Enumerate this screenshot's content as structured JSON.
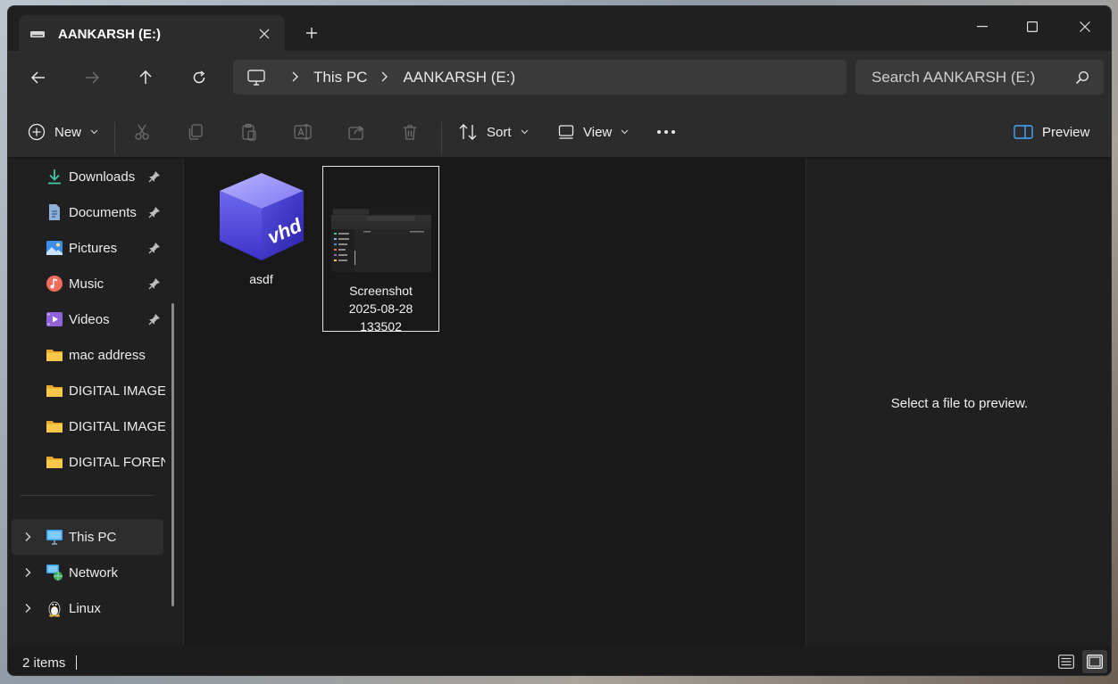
{
  "window": {
    "tab_title": "AANKARSH (E:)",
    "new_tab": "+"
  },
  "address": {
    "crumbs": [
      "This PC",
      "AANKARSH (E:)"
    ]
  },
  "search": {
    "placeholder": "Search AANKARSH (E:)"
  },
  "toolbar": {
    "new_label": "New",
    "sort_label": "Sort",
    "view_label": "View",
    "preview_label": "Preview"
  },
  "sidebar": {
    "quick_access": [
      {
        "label": "Downloads",
        "icon": "download-icon",
        "pinned": true
      },
      {
        "label": "Documents",
        "icon": "documents-icon",
        "pinned": true
      },
      {
        "label": "Pictures",
        "icon": "pictures-icon",
        "pinned": true
      },
      {
        "label": "Music",
        "icon": "music-icon",
        "pinned": true
      },
      {
        "label": "Videos",
        "icon": "videos-icon",
        "pinned": true
      },
      {
        "label": "mac address",
        "icon": "folder-icon",
        "pinned": false
      },
      {
        "label": "DIGITAL IMAGE",
        "icon": "folder-icon",
        "pinned": false
      },
      {
        "label": "DIGITAL IMAGE",
        "icon": "folder-icon",
        "pinned": false
      },
      {
        "label": "DIGITAL FORENC",
        "icon": "folder-icon",
        "pinned": false
      }
    ],
    "locations": [
      {
        "label": "This PC",
        "icon": "this-pc-icon",
        "selected": true
      },
      {
        "label": "Network",
        "icon": "network-icon",
        "selected": false
      },
      {
        "label": "Linux",
        "icon": "linux-icon",
        "selected": false
      }
    ]
  },
  "files": [
    {
      "name": "asdf",
      "icon": "vhd-icon",
      "badge": "vhd"
    },
    {
      "name": "Screenshot 2025-08-28 133502",
      "lines": [
        "Screenshot",
        "2025-08-28",
        "133502"
      ],
      "icon": "image-thumbnail",
      "selected": true
    }
  ],
  "preview": {
    "message": "Select a file to preview."
  },
  "status": {
    "item_count": "2 items"
  },
  "colors": {
    "window_bg": "#191919",
    "bar_bg": "#2c2c2c",
    "folder": "#f5c542",
    "accent_blue": "#4aa3ff"
  }
}
